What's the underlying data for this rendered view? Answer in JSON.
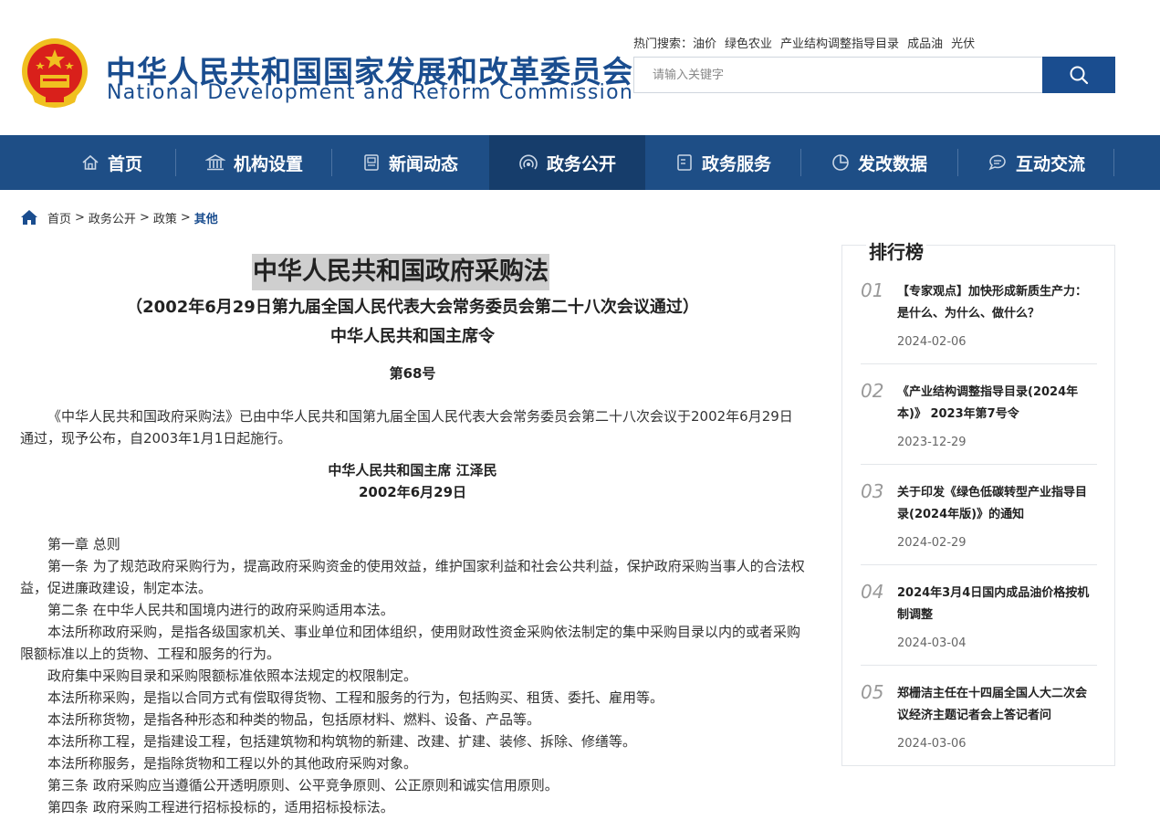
{
  "header": {
    "title_cn": "中华人民共和国国家发展和改革委员会",
    "title_en": "National Development and Reform Commission",
    "hot_search_label": "热门搜索：",
    "hot_search_terms": [
      "油价",
      "绿色农业",
      "产业结构调整指导目录",
      "成品油",
      "光伏"
    ],
    "search_placeholder": "请输入关键字"
  },
  "nav": {
    "items": [
      {
        "label": "首页",
        "icon": "home-icon"
      },
      {
        "label": "机构设置",
        "icon": "building-icon"
      },
      {
        "label": "新闻动态",
        "icon": "news-icon"
      },
      {
        "label": "政务公开",
        "icon": "broadcast-icon",
        "active": true
      },
      {
        "label": "政务服务",
        "icon": "document-icon"
      },
      {
        "label": "发改数据",
        "icon": "pie-chart-icon"
      },
      {
        "label": "互动交流",
        "icon": "chat-icon"
      }
    ]
  },
  "breadcrumb": {
    "items": [
      "首页",
      "政务公开",
      "政策"
    ],
    "separator": ">",
    "current": "其他"
  },
  "article": {
    "title": "中华人民共和国政府采购法",
    "subtitle": "（2002年6月29日第九届全国人民代表大会常务委员会第二十八次会议通过）",
    "order": "中华人民共和国主席令",
    "number": "第68号",
    "intro": "《中华人民共和国政府采购法》已由中华人民共和国第九届全国人民代表大会常务委员会第二十八次会议于2002年6月29日通过，现予公布，自2003年1月1日起施行。",
    "signature": "中华人民共和国主席 江泽民",
    "date": "2002年6月29日",
    "paragraphs": [
      "第一章 总则",
      "第一条 为了规范政府采购行为，提高政府采购资金的使用效益，维护国家利益和社会公共利益，保护政府采购当事人的合法权益，促进廉政建设，制定本法。",
      "第二条 在中华人民共和国境内进行的政府采购适用本法。",
      "本法所称政府采购，是指各级国家机关、事业单位和团体组织，使用财政性资金采购依法制定的集中采购目录以内的或者采购限额标准以上的货物、工程和服务的行为。",
      "政府集中采购目录和采购限额标准依照本法规定的权限制定。",
      "本法所称采购，是指以合同方式有偿取得货物、工程和服务的行为，包括购买、租赁、委托、雇用等。",
      "本法所称货物，是指各种形态和种类的物品，包括原材料、燃料、设备、产品等。",
      "本法所称工程，是指建设工程，包括建筑物和构筑物的新建、改建、扩建、装修、拆除、修缮等。",
      "本法所称服务，是指除货物和工程以外的其他政府采购对象。",
      "第三条 政府采购应当遵循公开透明原则、公平竞争原则、公正原则和诚实信用原则。",
      "第四条 政府采购工程进行招标投标的，适用招标投标法。"
    ]
  },
  "ranking": {
    "title": "排行榜",
    "items": [
      {
        "num": "01",
        "text": "【专家观点】加快形成新质生产力：是什么、为什么、做什么？",
        "date": "2024-02-06"
      },
      {
        "num": "02",
        "text": "《产业结构调整指导目录(2024年本)》 2023年第7号令",
        "date": "2023-12-29"
      },
      {
        "num": "03",
        "text": "关于印发《绿色低碳转型产业指导目录(2024年版)》的通知",
        "date": "2024-02-29"
      },
      {
        "num": "04",
        "text": "2024年3月4日国内成品油价格按机制调整",
        "date": "2024-03-04"
      },
      {
        "num": "05",
        "text": "郑栅洁主任在十四届全国人大二次会议经济主题记者会上答记者问",
        "date": "2024-03-06"
      }
    ]
  },
  "colors": {
    "brand_blue": "#1a4d8f",
    "nav_bg": "#1e4e86",
    "nav_active_bg": "#163d6b",
    "title_highlight": "#cfcfcf",
    "emblem_red": "#d9201b",
    "emblem_gold": "#f0c020"
  }
}
